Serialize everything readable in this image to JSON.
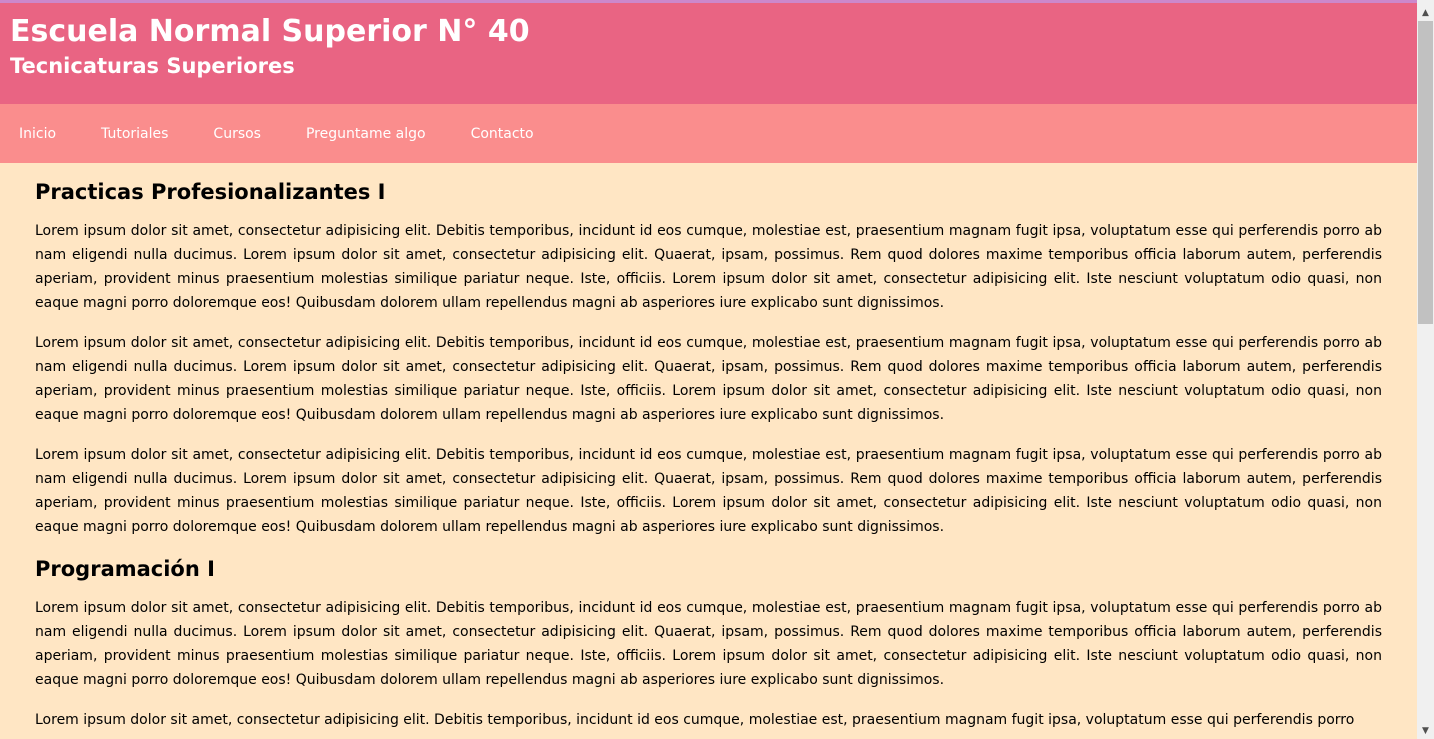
{
  "header": {
    "title": "Escuela Normal Superior N° 40",
    "subtitle": "Tecnicaturas Superiores"
  },
  "nav": {
    "items": [
      "Inicio",
      "Tutoriales",
      "Cursos",
      "Preguntame algo",
      "Contacto"
    ]
  },
  "sections": [
    {
      "title": "Practicas Profesionalizantes I",
      "paragraphs": [
        "Lorem ipsum dolor sit amet, consectetur adipisicing elit. Debitis temporibus, incidunt id eos cumque, molestiae est, praesentium magnam fugit ipsa, voluptatum esse qui perferendis porro ab nam eligendi nulla ducimus. Lorem ipsum dolor sit amet, consectetur adipisicing elit. Quaerat, ipsam, possimus. Rem quod dolores maxime temporibus officia laborum autem, perferendis aperiam, provident minus praesentium molestias similique pariatur neque. Iste, officiis. Lorem ipsum dolor sit amet, consectetur adipisicing elit. Iste nesciunt voluptatum odio quasi, non eaque magni porro doloremque eos! Quibusdam dolorem ullam repellendus magni ab asperiores iure explicabo sunt dignissimos.",
        "Lorem ipsum dolor sit amet, consectetur adipisicing elit. Debitis temporibus, incidunt id eos cumque, molestiae est, praesentium magnam fugit ipsa, voluptatum esse qui perferendis porro ab nam eligendi nulla ducimus. Lorem ipsum dolor sit amet, consectetur adipisicing elit. Quaerat, ipsam, possimus. Rem quod dolores maxime temporibus officia laborum autem, perferendis aperiam, provident minus praesentium molestias similique pariatur neque. Iste, officiis. Lorem ipsum dolor sit amet, consectetur adipisicing elit. Iste nesciunt voluptatum odio quasi, non eaque magni porro doloremque eos! Quibusdam dolorem ullam repellendus magni ab asperiores iure explicabo sunt dignissimos.",
        "Lorem ipsum dolor sit amet, consectetur adipisicing elit. Debitis temporibus, incidunt id eos cumque, molestiae est, praesentium magnam fugit ipsa, voluptatum esse qui perferendis porro ab nam eligendi nulla ducimus. Lorem ipsum dolor sit amet, consectetur adipisicing elit. Quaerat, ipsam, possimus. Rem quod dolores maxime temporibus officia laborum autem, perferendis aperiam, provident minus praesentium molestias similique pariatur neque. Iste, officiis. Lorem ipsum dolor sit amet, consectetur adipisicing elit. Iste nesciunt voluptatum odio quasi, non eaque magni porro doloremque eos! Quibusdam dolorem ullam repellendus magni ab asperiores iure explicabo sunt dignissimos."
      ]
    },
    {
      "title": "Programación I",
      "paragraphs": [
        "Lorem ipsum dolor sit amet, consectetur adipisicing elit. Debitis temporibus, incidunt id eos cumque, molestiae est, praesentium magnam fugit ipsa, voluptatum esse qui perferendis porro ab nam eligendi nulla ducimus. Lorem ipsum dolor sit amet, consectetur adipisicing elit. Quaerat, ipsam, possimus. Rem quod dolores maxime temporibus officia laborum autem, perferendis aperiam, provident minus praesentium molestias similique pariatur neque. Iste, officiis. Lorem ipsum dolor sit amet, consectetur adipisicing elit. Iste nesciunt voluptatum odio quasi, non eaque magni porro doloremque eos! Quibusdam dolorem ullam repellendus magni ab asperiores iure explicabo sunt dignissimos.",
        "Lorem ipsum dolor sit amet, consectetur adipisicing elit. Debitis temporibus, incidunt id eos cumque, molestiae est, praesentium magnam fugit ipsa, voluptatum esse qui perferendis porro"
      ]
    }
  ],
  "scrollbar": {
    "up_icon": "triangle-up",
    "down_icon": "triangle-down"
  },
  "colors": {
    "header_bg": "#e96483",
    "nav_bg": "#fa8d8d",
    "content_bg": "#ffe6c4",
    "header_text": "#ffffff",
    "body_text": "#000000"
  }
}
